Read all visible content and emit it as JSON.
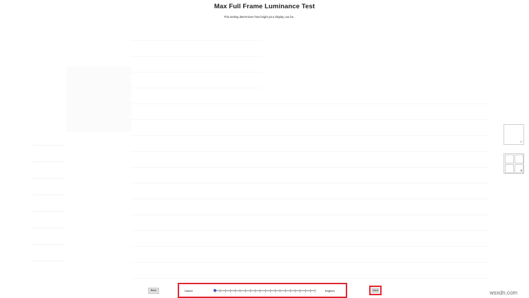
{
  "header": {
    "title": "Max Full Frame Luminance Test",
    "subtitle": "This setting determines how bright your display can be."
  },
  "tiles": {
    "single_mark": "✓",
    "grid_mark": "✕"
  },
  "footer": {
    "back_label": "Back",
    "next_label": "Next",
    "slider": {
      "min_label": "Darker",
      "max_label": "Brighter",
      "value_fraction": 0.0,
      "tick_count": 21
    }
  },
  "watermark": "wsxdn.com",
  "colors": {
    "highlight": "#e2242f",
    "thumb": "#3a58c8",
    "button_bg": "#d9d9d9"
  }
}
